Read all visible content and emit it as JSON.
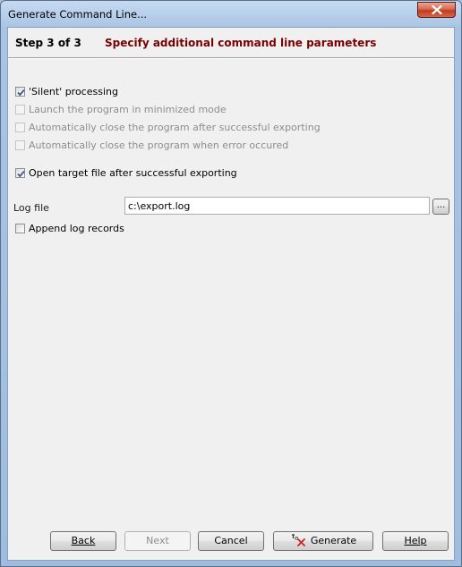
{
  "window": {
    "title": "Generate Command Line..."
  },
  "header": {
    "step": "Step 3 of 3",
    "description": "Specify additional command line parameters"
  },
  "options": [
    {
      "label": "'Silent' processing",
      "checked": true,
      "enabled": true
    },
    {
      "label": "Launch the program in minimized mode",
      "checked": false,
      "enabled": false
    },
    {
      "label": "Automatically close the program after successful exporting",
      "checked": false,
      "enabled": false
    },
    {
      "label": "Automatically close the program when error occured",
      "checked": false,
      "enabled": false
    },
    {
      "label": "Open target file after successful exporting",
      "checked": true,
      "enabled": true
    }
  ],
  "log": {
    "label": "Log file",
    "value": "c:\\export.log",
    "browse_label": "...",
    "append_label": "Append log records",
    "append_checked": false
  },
  "buttons": {
    "back": {
      "label": "Back",
      "enabled": true
    },
    "next": {
      "label": "Next",
      "enabled": false
    },
    "cancel": {
      "label": "Cancel",
      "enabled": true
    },
    "generate": {
      "label": "Generate",
      "enabled": true
    },
    "help": {
      "label": "Help",
      "enabled": true
    }
  },
  "colors": {
    "step_description": "#7a0000",
    "client_bg": "#f0f0f0",
    "close_button": "#c2391f"
  }
}
